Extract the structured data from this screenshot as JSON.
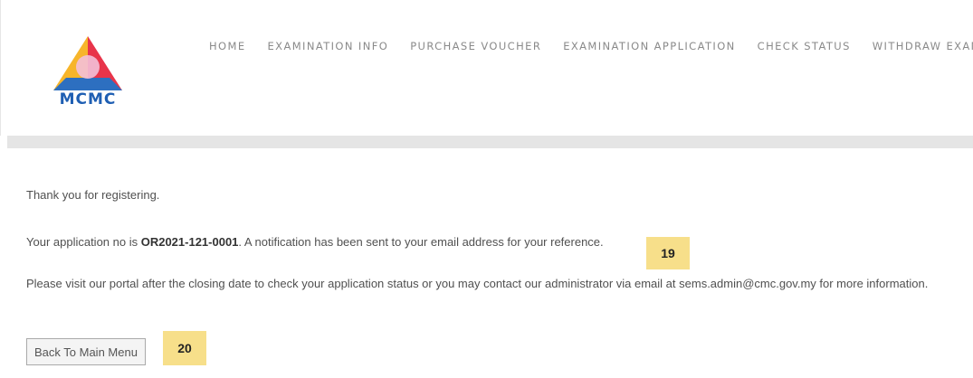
{
  "logo": {
    "text": "MCMC"
  },
  "nav": {
    "items": [
      {
        "label": "HOME"
      },
      {
        "label": "EXAMINATION INFO"
      },
      {
        "label": "PURCHASE VOUCHER"
      },
      {
        "label": "EXAMINATION APPLICATION"
      },
      {
        "label": "CHECK STATUS"
      },
      {
        "label": "WITHDRAW EXAM"
      }
    ]
  },
  "content": {
    "thanks": "Thank you for registering.",
    "app_prefix": "Your application no is ",
    "app_no": "OR2021-121-0001",
    "app_suffix": ". A notification has been sent to your email address for your reference.",
    "portal_note": "Please visit our portal after the closing date to check your application status or you may contact our administrator via email at sems.admin@cmc.gov.my for more information."
  },
  "badges": {
    "b19": "19",
    "b20": "20"
  },
  "buttons": {
    "back_label": "Back To Main Menu"
  },
  "colors": {
    "badge": "#f7df8a",
    "band": "#e5e5e5",
    "logo_red": "#e8344a",
    "logo_yellow": "#f7b52a",
    "logo_blue": "#2d6fc0"
  }
}
